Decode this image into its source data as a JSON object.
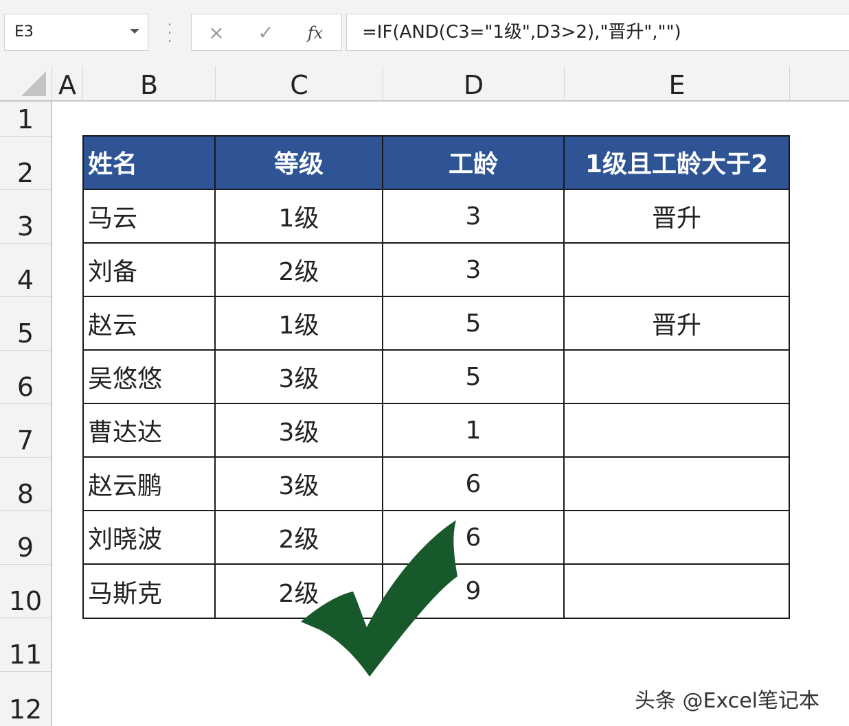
{
  "formula_bar": {
    "name_box": "E3",
    "cancel_icon": "×",
    "enter_icon": "✓",
    "fx_label": "fx",
    "formula": "=IF(AND(C3=\"1级\",D3>2),\"晋升\",\"\")"
  },
  "columns": [
    "A",
    "B",
    "C",
    "D",
    "E"
  ],
  "rows": [
    "1",
    "2",
    "3",
    "4",
    "5",
    "6",
    "7",
    "8",
    "9",
    "10",
    "11",
    "12"
  ],
  "table": {
    "headers": [
      "姓名",
      "等级",
      "工龄",
      "1级且工龄大于2"
    ],
    "rows": [
      [
        "马云",
        "1级",
        "3",
        "晋升"
      ],
      [
        "刘备",
        "2级",
        "3",
        ""
      ],
      [
        "赵云",
        "1级",
        "5",
        "晋升"
      ],
      [
        "吴悠悠",
        "3级",
        "5",
        ""
      ],
      [
        "曹达达",
        "3级",
        "1",
        ""
      ],
      [
        "赵云鹏",
        "3级",
        "6",
        ""
      ],
      [
        "刘晓波",
        "2级",
        "6",
        ""
      ],
      [
        "马斯克",
        "2级",
        "9",
        ""
      ]
    ]
  },
  "overlay": {
    "checkmark_icon": "checkmark-icon",
    "watermark": "头条 @Excel笔记本"
  },
  "colors": {
    "header_fill": "#2e5496",
    "header_text": "#ffffff",
    "checkmark": "#17592b"
  }
}
